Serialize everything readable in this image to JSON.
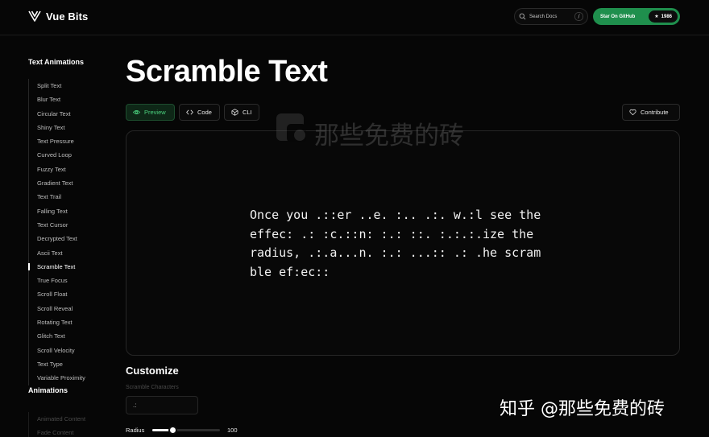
{
  "header": {
    "logo_text": "Vue Bits",
    "search_label": "Search Docs",
    "search_shortcut": "/",
    "github_label": "Star On GitHub",
    "github_stars": "1986"
  },
  "sidebar": {
    "section1_title": "Text Animations",
    "items": [
      {
        "label": "Split Text"
      },
      {
        "label": "Blur Text"
      },
      {
        "label": "Circular Text"
      },
      {
        "label": "Shiny Text"
      },
      {
        "label": "Text Pressure"
      },
      {
        "label": "Curved Loop"
      },
      {
        "label": "Fuzzy Text"
      },
      {
        "label": "Gradient Text"
      },
      {
        "label": "Text Trail"
      },
      {
        "label": "Falling Text"
      },
      {
        "label": "Text Cursor"
      },
      {
        "label": "Decrypted Text"
      },
      {
        "label": "Ascii Text"
      },
      {
        "label": "Scramble Text",
        "active": true
      },
      {
        "label": "True Focus"
      },
      {
        "label": "Scroll Float"
      },
      {
        "label": "Scroll Reveal"
      },
      {
        "label": "Rotating Text"
      },
      {
        "label": "Glitch Text"
      },
      {
        "label": "Scroll Velocity"
      },
      {
        "label": "Text Type"
      },
      {
        "label": "Variable Proximity"
      }
    ],
    "section2_title": "Animations",
    "section2_items": [
      {
        "label": "Animated Content"
      },
      {
        "label": "Fade Content"
      }
    ]
  },
  "main": {
    "title": "Scramble Text",
    "tabs": {
      "preview": "Preview",
      "code": "Code",
      "cli": "CLI"
    },
    "contribute_label": "Contribute",
    "preview_text": "Once you .::er ..e. :.. .:. w.:l see the effec: .: :c.::n: :.: ::. :.:.:.ize the radius, .:.a...n. :.: ...:: .: .he scram ble ef:ec::",
    "customize_title": "Customize",
    "scramble_chars_label": "Scramble Characters",
    "scramble_chars_value": ".:",
    "radius_label": "Radius",
    "radius_value": "100",
    "radius_fraction": 0.3
  },
  "watermark": {
    "center_text": "那些免费的砖",
    "bottom_text": "知乎 @那些免费的砖"
  },
  "colors": {
    "accent_green": "#1f8f4d",
    "preview_tab_text": "#4bd17e",
    "background": "#060606"
  }
}
